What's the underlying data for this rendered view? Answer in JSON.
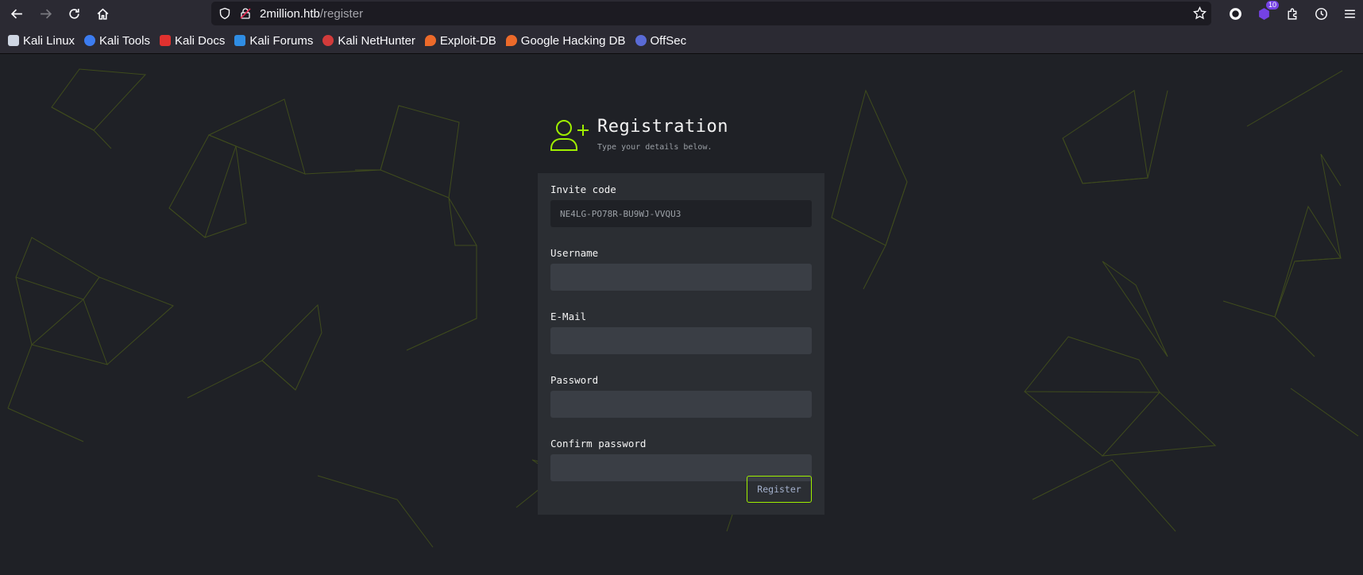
{
  "browser": {
    "url_host": "2million.htb",
    "url_path": "/register",
    "extension_badge": "10"
  },
  "bookmarks": [
    {
      "label": "Kali Linux",
      "icon": "kali-dragon-icon",
      "color": "#cfd6e3"
    },
    {
      "label": "Kali Tools",
      "icon": "kali-tools-icon",
      "color": "#3c7cf0"
    },
    {
      "label": "Kali Docs",
      "icon": "kali-docs-icon",
      "color": "#e0312f"
    },
    {
      "label": "Kali Forums",
      "icon": "kali-forums-icon",
      "color": "#2f8de4"
    },
    {
      "label": "Kali NetHunter",
      "icon": "nethunter-icon",
      "color": "#d23b3b"
    },
    {
      "label": "Exploit-DB",
      "icon": "exploit-db-icon",
      "color": "#ec6a2a"
    },
    {
      "label": "Google Hacking DB",
      "icon": "ghdb-icon",
      "color": "#ec6a2a"
    },
    {
      "label": "OffSec",
      "icon": "offsec-icon",
      "color": "#5a6bd6"
    }
  ],
  "header": {
    "title": "Registration",
    "subtitle": "Type your details below."
  },
  "form": {
    "invite_label": "Invite code",
    "invite_value": "NE4LG-PO78R-BU9WJ-VVQU3",
    "username_label": "Username",
    "email_label": "E-Mail",
    "password_label": "Password",
    "confirm_label": "Confirm password",
    "submit_label": "Register"
  },
  "colors": {
    "accent": "#9fef00",
    "background": "#1f2126",
    "card": "#2b2e33"
  }
}
